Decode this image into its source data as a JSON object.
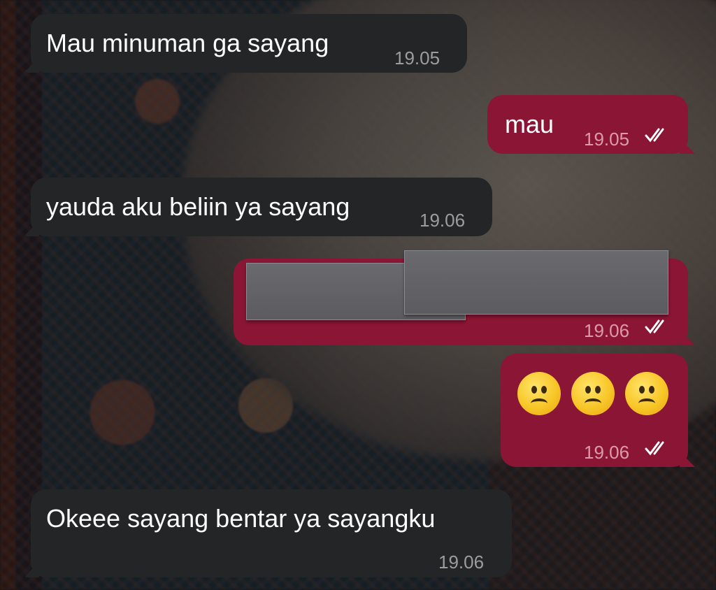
{
  "messages": [
    {
      "direction": "incoming",
      "text": "Mau minuman ga sayang",
      "time": "19.05"
    },
    {
      "direction": "outgoing",
      "text": "mau",
      "time": "19.05",
      "status": "read"
    },
    {
      "direction": "incoming",
      "text": "yauda aku beliin ya sayang",
      "time": "19.06"
    },
    {
      "direction": "outgoing",
      "text": "",
      "redacted": true,
      "time": "19.06",
      "status": "read"
    },
    {
      "direction": "outgoing",
      "emoji": [
        "frowning-face",
        "frowning-face",
        "frowning-face"
      ],
      "time": "19.06",
      "status": "read"
    },
    {
      "direction": "incoming",
      "text": "Okeee sayang bentar ya sayangku",
      "time": "19.06"
    }
  ],
  "colors": {
    "incoming_bubble": "#232526",
    "outgoing_bubble": "#8b1535",
    "text": "#ffffff"
  }
}
